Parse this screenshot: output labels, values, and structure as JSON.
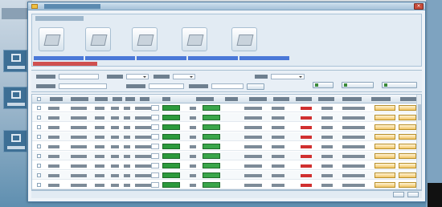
{
  "toolbar": {
    "tools": [
      {
        "label": ""
      },
      {
        "label": ""
      },
      {
        "label": ""
      },
      {
        "label": ""
      },
      {
        "label": ""
      }
    ]
  },
  "grid": {
    "row_count": 9
  },
  "colors": {
    "window_border": "#4d7ca3",
    "titlebar": "#a5c1d8",
    "action_green": "#2c9a3c",
    "status_red": "#d03030",
    "orange_button": "#f2c766",
    "link_blue": "#4a78d8"
  }
}
